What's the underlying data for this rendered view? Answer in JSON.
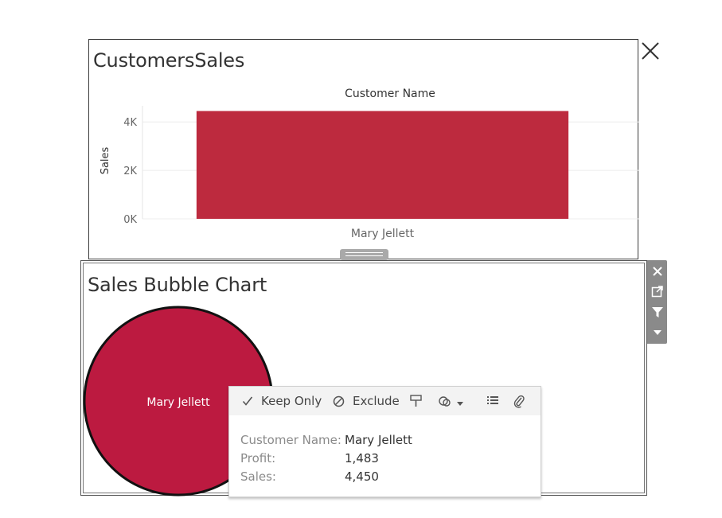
{
  "top_panel": {
    "title": "CustomersSales",
    "header_label": "Customer Name",
    "y_axis_label": "Sales",
    "close_icon": "close-icon"
  },
  "chart_data": {
    "type": "bar",
    "title": "CustomersSales",
    "categories": [
      "Mary Jellett"
    ],
    "values": [
      4450
    ],
    "xlabel": "Customer Name",
    "ylabel": "Sales",
    "ylim": [
      0,
      4500
    ],
    "yticks": [
      0,
      2000,
      4000
    ],
    "ytick_labels": [
      "0K",
      "2K",
      "4K"
    ],
    "grid": true,
    "colors": {
      "bar": "#bd2a3e"
    }
  },
  "bottom_panel": {
    "title": "Sales Bubble Chart",
    "bubble": {
      "label": "Mary Jellett",
      "color": "#bc1a40",
      "sales": 4450,
      "profit": 1483
    }
  },
  "side_toolbar": {
    "items": [
      {
        "name": "close-icon"
      },
      {
        "name": "open-external-icon"
      },
      {
        "name": "filter-icon"
      },
      {
        "name": "more-options-icon"
      }
    ]
  },
  "tooltip": {
    "actions": {
      "keep_only": "Keep Only",
      "exclude": "Exclude"
    },
    "icons": [
      "checkmark-icon",
      "exclude-icon",
      "highlight-icon",
      "group-icon",
      "view-data-icon",
      "attach-icon"
    ],
    "fields": [
      {
        "label": "Customer Name:",
        "value": "Mary Jellett"
      },
      {
        "label": "Profit:",
        "value": "1,483"
      },
      {
        "label": "Sales:",
        "value": "4,450"
      }
    ]
  }
}
